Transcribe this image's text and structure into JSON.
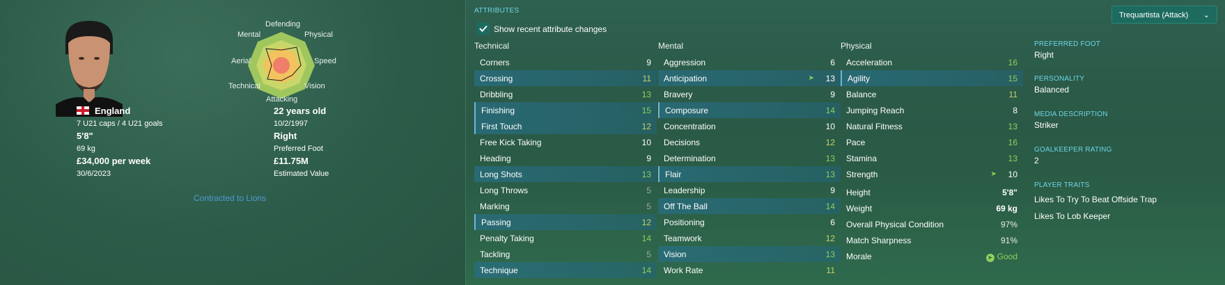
{
  "player": {
    "nationality": "England",
    "caps": "7 U21 caps / 4 U21 goals",
    "height": "5'8\"",
    "weight": "69 kg",
    "wage": "£34,000 per week",
    "contract_end": "30/6/2023",
    "age": "22 years old",
    "dob": "10/2/1997",
    "foot": "Right",
    "foot_label": "Preferred Foot",
    "value": "£11.75M",
    "value_label": "Estimated Value",
    "contract_note": "Contracted to Lions"
  },
  "radar": {
    "labels": {
      "defending": "Defending",
      "physical": "Physical",
      "speed": "Speed",
      "vision": "Vision",
      "attacking": "Attacking",
      "technical": "Technical",
      "aerial": "Aerial",
      "mental": "Mental"
    }
  },
  "attributes": {
    "title": "ATTRIBUTES",
    "show_changes": "Show recent attribute changes",
    "role": "Trequartista (Attack)",
    "technical_title": "Technical",
    "mental_title": "Mental",
    "physical_title": "Physical",
    "technical": [
      {
        "name": "Corners",
        "value": "9"
      },
      {
        "name": "Crossing",
        "value": "11"
      },
      {
        "name": "Dribbling",
        "value": "13"
      },
      {
        "name": "Finishing",
        "value": "15"
      },
      {
        "name": "First Touch",
        "value": "12"
      },
      {
        "name": "Free Kick Taking",
        "value": "10"
      },
      {
        "name": "Heading",
        "value": "9"
      },
      {
        "name": "Long Shots",
        "value": "13"
      },
      {
        "name": "Long Throws",
        "value": "5"
      },
      {
        "name": "Marking",
        "value": "5"
      },
      {
        "name": "Passing",
        "value": "12"
      },
      {
        "name": "Penalty Taking",
        "value": "14"
      },
      {
        "name": "Tackling",
        "value": "5"
      },
      {
        "name": "Technique",
        "value": "14"
      }
    ],
    "mental": [
      {
        "name": "Aggression",
        "value": "6"
      },
      {
        "name": "Anticipation",
        "value": "13"
      },
      {
        "name": "Bravery",
        "value": "9"
      },
      {
        "name": "Composure",
        "value": "14"
      },
      {
        "name": "Concentration",
        "value": "10"
      },
      {
        "name": "Decisions",
        "value": "12"
      },
      {
        "name": "Determination",
        "value": "13"
      },
      {
        "name": "Flair",
        "value": "13"
      },
      {
        "name": "Leadership",
        "value": "9"
      },
      {
        "name": "Off The Ball",
        "value": "14"
      },
      {
        "name": "Positioning",
        "value": "6"
      },
      {
        "name": "Teamwork",
        "value": "12"
      },
      {
        "name": "Vision",
        "value": "13"
      },
      {
        "name": "Work Rate",
        "value": "11"
      }
    ],
    "physical": [
      {
        "name": "Acceleration",
        "value": "16"
      },
      {
        "name": "Agility",
        "value": "15"
      },
      {
        "name": "Balance",
        "value": "11"
      },
      {
        "name": "Jumping Reach",
        "value": "8"
      },
      {
        "name": "Natural Fitness",
        "value": "13"
      },
      {
        "name": "Pace",
        "value": "16"
      },
      {
        "name": "Stamina",
        "value": "13"
      },
      {
        "name": "Strength",
        "value": "10"
      }
    ],
    "physical_extra": [
      {
        "name": "Height",
        "value": "5'8\""
      },
      {
        "name": "Weight",
        "value": "69 kg"
      },
      {
        "name": "Overall Physical Condition",
        "value": "97%"
      },
      {
        "name": "Match Sharpness",
        "value": "91%"
      },
      {
        "name": "Morale",
        "value": "Good"
      }
    ]
  },
  "info": {
    "preferred_foot_label": "PREFERRED FOOT",
    "preferred_foot": "Right",
    "personality_label": "PERSONALITY",
    "personality": "Balanced",
    "media_label": "MEDIA DESCRIPTION",
    "media": "Striker",
    "gk_label": "GOALKEEPER RATING",
    "gk": "2",
    "traits_label": "PLAYER TRAITS",
    "traits": [
      "Likes To Try To Beat Offside Trap",
      "Likes To Lob Keeper"
    ]
  },
  "colors": {
    "green_value": "#8fd05a",
    "yellow_value": "#c7d46a",
    "low_value": "#9ea7a2",
    "accent_label": "#6fd4e6",
    "highlight_row": "#2a6e82"
  }
}
